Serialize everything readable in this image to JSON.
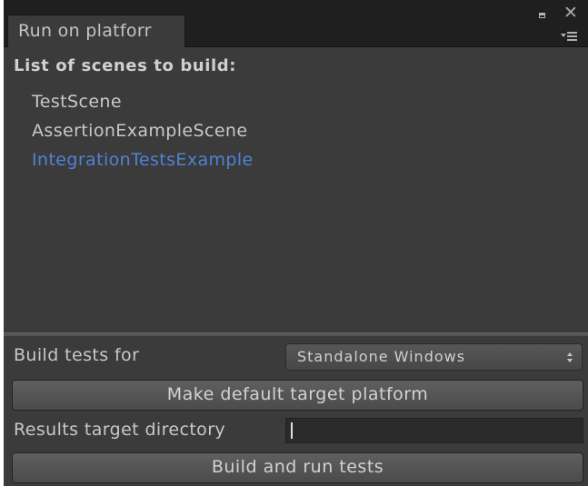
{
  "window": {
    "tab_title": "Run on platforr"
  },
  "scenes": {
    "title": "List of scenes to build:",
    "items": [
      {
        "label": "TestScene",
        "selected": false
      },
      {
        "label": "AssertionExampleScene",
        "selected": false
      },
      {
        "label": "IntegrationTestsExample",
        "selected": true
      }
    ]
  },
  "build": {
    "platform_label": "Build tests for",
    "platform_value": "Standalone Windows",
    "make_default_label": "Make default target platform",
    "results_dir_label": "Results target directory",
    "results_dir_value": "",
    "run_button_label": "Build and run tests"
  },
  "colors": {
    "selected_text": "#4f82d6",
    "panel_bg": "#3b3b3b"
  },
  "icons": {
    "maximize": "maximize-icon",
    "close": "close-icon",
    "menu": "context-menu-icon",
    "popup_arrows": "popup-arrows-icon"
  }
}
